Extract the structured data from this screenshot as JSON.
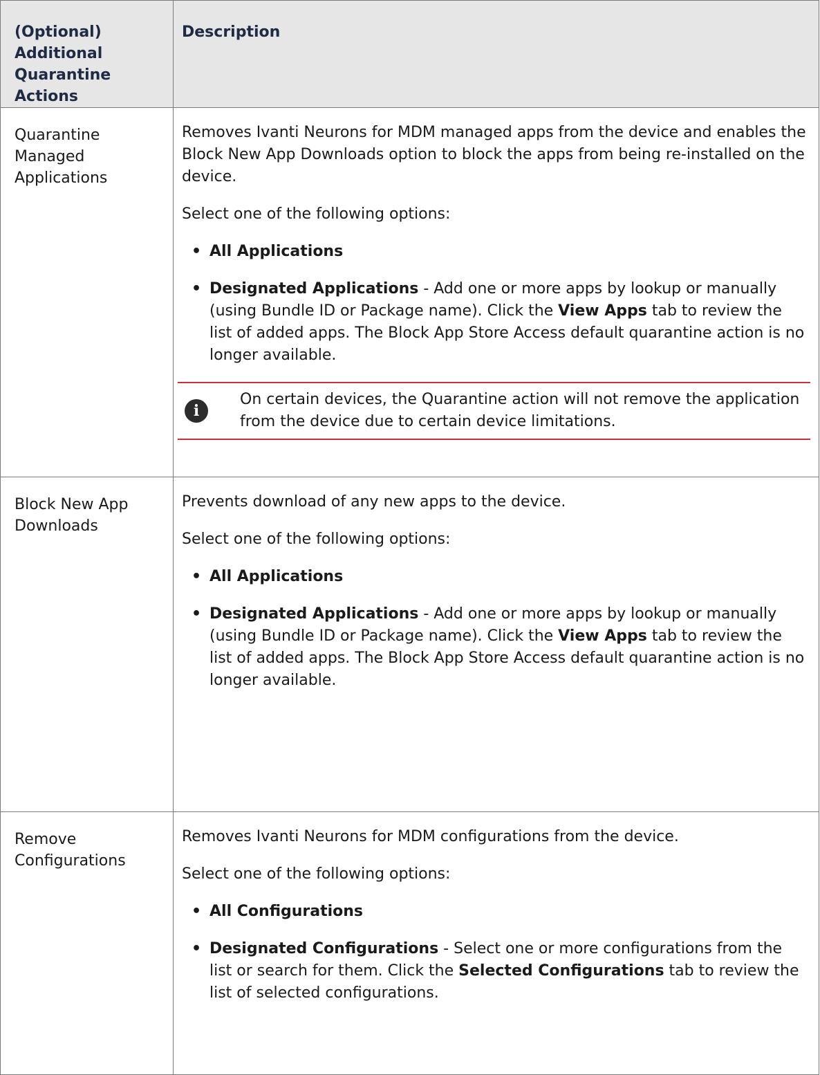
{
  "table": {
    "headers": {
      "action": "(Optional) Additional Quarantine Actions",
      "description": "Description"
    },
    "rows": [
      {
        "action": "Quarantine Managed Applications",
        "intro": "Removes Ivanti Neurons for MDM managed apps from the device and enables the Block New App Downloads option to block the apps from being re-installed on the device.",
        "select_text": "Select one of the following options:",
        "option_all": "All Applications",
        "designated": {
          "label": "Designated Applications",
          "text1": " - Add one or more apps by lookup or manually (using Bundle ID or Package name). Click the ",
          "bold2": "View Apps",
          "text2": " tab to review the list of added apps. The Block App Store Access default quarantine action is no longer available."
        },
        "note": "On certain devices, the Quarantine action will not remove the application from the device due to certain device limitations."
      },
      {
        "action": "Block New App Downloads",
        "intro": "Prevents download of any new apps to the device.",
        "select_text": "Select one of the following options:",
        "option_all": "All Applications",
        "designated": {
          "label": "Designated Applications",
          "text1": " - Add one or more apps by lookup or manually (using Bundle ID or Package name). Click the ",
          "bold2": "View Apps",
          "text2": " tab to review the list of added apps. The Block App Store Access default quarantine action is no longer available."
        }
      },
      {
        "action": "Remove Configurations",
        "intro": "Removes Ivanti Neurons for MDM configurations from the device.",
        "select_text": "Select one of the following options:",
        "option_all": "All Configurations",
        "designated": {
          "label": "Designated Configurations",
          "text1": " - Select one or more configurations from the list or search for them. Click the ",
          "bold2": "Selected Configurations",
          "text2": " tab to review the list of selected configurations."
        }
      }
    ]
  },
  "icons": {
    "note": "info-icon"
  }
}
